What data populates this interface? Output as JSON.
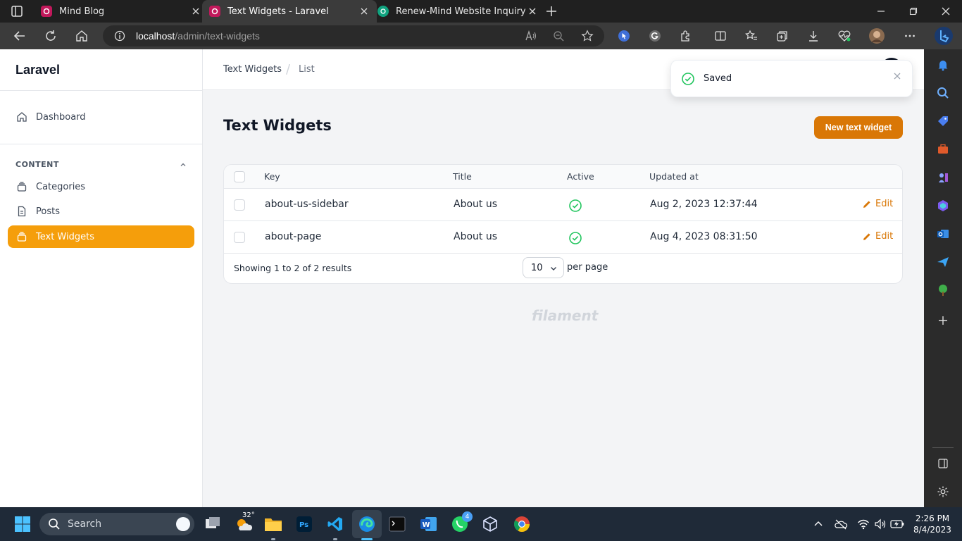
{
  "browser": {
    "tabs": [
      {
        "title": "Mind Blog",
        "favicon_color": "#c2185b"
      },
      {
        "title": "Text Widgets - Laravel",
        "favicon_color": "#c2185b"
      },
      {
        "title": "Renew-Mind Website Inquiry",
        "favicon_color": "#10a37f"
      }
    ],
    "active_tab_index": 1,
    "url_host": "localhost",
    "url_path": "/admin/text-widgets"
  },
  "app": {
    "brand": "Laravel",
    "nav": {
      "dashboard": "Dashboard",
      "group_label": "CONTENT",
      "items": [
        {
          "label": "Categories",
          "icon": "collection-icon"
        },
        {
          "label": "Posts",
          "icon": "document-icon"
        },
        {
          "label": "Text Widgets",
          "icon": "collection-icon",
          "active": true
        }
      ]
    },
    "breadcrumb": [
      "Text Widgets",
      "List"
    ],
    "heading": "Text Widgets",
    "new_button": "New text widget",
    "table": {
      "columns": [
        "Key",
        "Title",
        "Active",
        "Updated at"
      ],
      "rows": [
        {
          "key": "about-us-sidebar",
          "title": "About us",
          "active": true,
          "updated_at": "Aug 2, 2023 12:37:44",
          "action": "Edit"
        },
        {
          "key": "about-page",
          "title": "About us",
          "active": true,
          "updated_at": "Aug 4, 2023 08:31:50",
          "action": "Edit"
        }
      ],
      "summary": "Showing 1 to 2 of 2 results",
      "per_page_value": "10",
      "per_page_label": "per page"
    },
    "footer_brand": "filament",
    "toast": {
      "message": "Saved",
      "status": "success"
    },
    "colors": {
      "primary": "#f59e0b",
      "primary_dark": "#d97706",
      "success": "#22c55e"
    }
  },
  "taskbar": {
    "search_placeholder": "Search",
    "weather_temp": "32°",
    "whatsapp_badge": "4",
    "time": "2:26 PM",
    "date": "8/4/2023"
  }
}
